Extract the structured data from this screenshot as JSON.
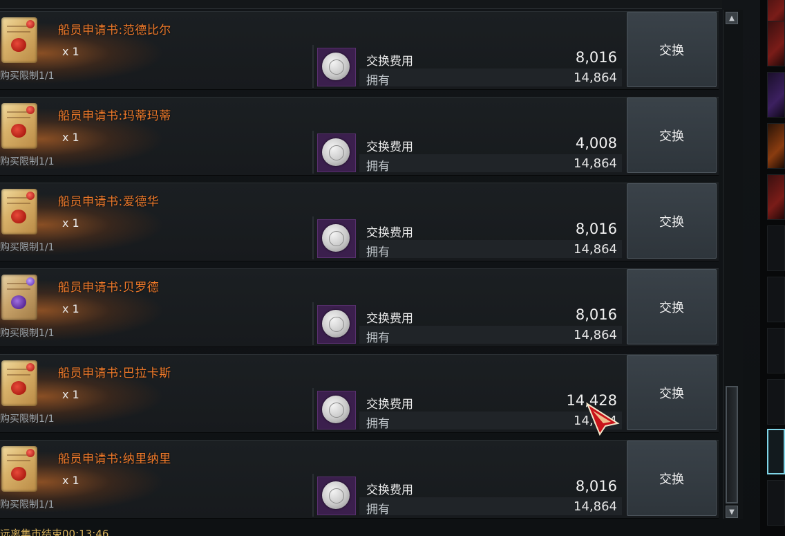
{
  "rows": [
    {
      "name": "船员申请书:范德比尔",
      "qty": "x 1",
      "limit": "购买限制1/1",
      "cost_label": "交换费用",
      "cost": "8,016",
      "owned_label": "拥有",
      "owned": "14,864",
      "button": "交换",
      "seal_color": "red"
    },
    {
      "name": "船员申请书:玛蒂玛蒂",
      "qty": "x 1",
      "limit": "购买限制1/1",
      "cost_label": "交换费用",
      "cost": "4,008",
      "owned_label": "拥有",
      "owned": "14,864",
      "button": "交换",
      "seal_color": "red"
    },
    {
      "name": "船员申请书:爱德华",
      "qty": "x 1",
      "limit": "购买限制1/1",
      "cost_label": "交换费用",
      "cost": "8,016",
      "owned_label": "拥有",
      "owned": "14,864",
      "button": "交换",
      "seal_color": "red"
    },
    {
      "name": "船员申请书:贝罗德",
      "qty": "x 1",
      "limit": "购买限制1/1",
      "cost_label": "交换费用",
      "cost": "8,016",
      "owned_label": "拥有",
      "owned": "14,864",
      "button": "交换",
      "seal_color": "purple"
    },
    {
      "name": "船员申请书:巴拉卡斯",
      "qty": "x 1",
      "limit": "购买限制1/1",
      "cost_label": "交换费用",
      "cost": "14,428",
      "owned_label": "拥有",
      "owned": "14,864",
      "button": "交换",
      "seal_color": "red"
    },
    {
      "name": "船员申请书:纳里纳里",
      "qty": "x 1",
      "limit": "购买限制1/1",
      "cost_label": "交换费用",
      "cost": "8,016",
      "owned_label": "拥有",
      "owned": "14,864",
      "button": "交换",
      "seal_color": "red"
    }
  ],
  "scrollbar": {
    "up_arrow": "▲",
    "down_arrow": "▼"
  },
  "footer": {
    "timer_text": "远离集市结束00:13:46"
  },
  "colors": {
    "item_name": "#f07a2a",
    "button_bg": "#333b42",
    "coin_bg": "#3b1f4d",
    "limit_text": "#9aa3aa"
  }
}
